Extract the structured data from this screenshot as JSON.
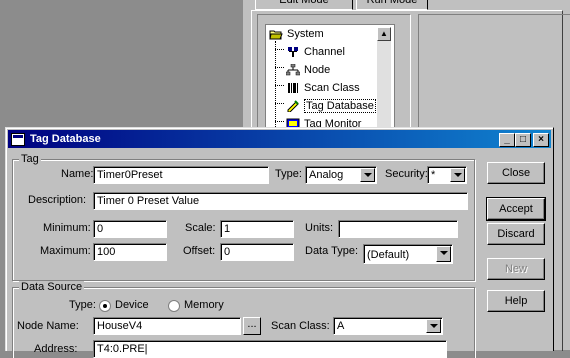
{
  "background": {
    "tabs": [
      {
        "label": "Edit Mode",
        "mnemonic": "E"
      },
      {
        "label": "Run Mode",
        "mnemonic": "R"
      }
    ],
    "tree": {
      "items": [
        {
          "label": "System",
          "icon": "folder-open-icon"
        },
        {
          "label": "Channel",
          "icon": "channel-icon"
        },
        {
          "label": "Node",
          "icon": "node-icon"
        },
        {
          "label": "Scan Class",
          "icon": "scan-class-icon"
        },
        {
          "label": "Tag Database",
          "icon": "tag-database-icon"
        },
        {
          "label": "Tag Monitor",
          "icon": "tag-monitor-icon"
        }
      ]
    }
  },
  "dialog": {
    "title": "Tag Database",
    "tag_group": {
      "label": "Tag",
      "name_label": "Name:",
      "name_value": "Timer0Preset",
      "type_label": "Type:",
      "type_value": "Analog",
      "security_label": "Security:",
      "security_value": "*",
      "description_label": "Description:",
      "description_value": "Timer 0 Preset Value",
      "minimum_label": "Minimum:",
      "minimum_value": "0",
      "scale_label": "Scale:",
      "scale_value": "1",
      "units_label": "Units:",
      "units_value": "",
      "maximum_label": "Maximum:",
      "maximum_value": "100",
      "offset_label": "Offset:",
      "offset_value": "0",
      "datatype_label": "Data Type:",
      "datatype_value": "(Default)"
    },
    "source_group": {
      "label": "Data Source",
      "type_label": "Type:",
      "device_label": "Device",
      "memory_label": "Memory",
      "selected": "Device",
      "nodename_label": "Node Name:",
      "nodename_value": "HouseV4",
      "ellipsis_label": "...",
      "scanclass_label": "Scan Class:",
      "scanclass_value": "A",
      "address_label": "Address:",
      "address_value": "T4:0.PRE|"
    },
    "buttons": {
      "close": "Close",
      "accept": "Accept",
      "discard": "Discard",
      "new": "New",
      "help": "Help"
    },
    "title_buttons": {
      "minimize": "_",
      "maximize": "□",
      "close": "×"
    }
  }
}
